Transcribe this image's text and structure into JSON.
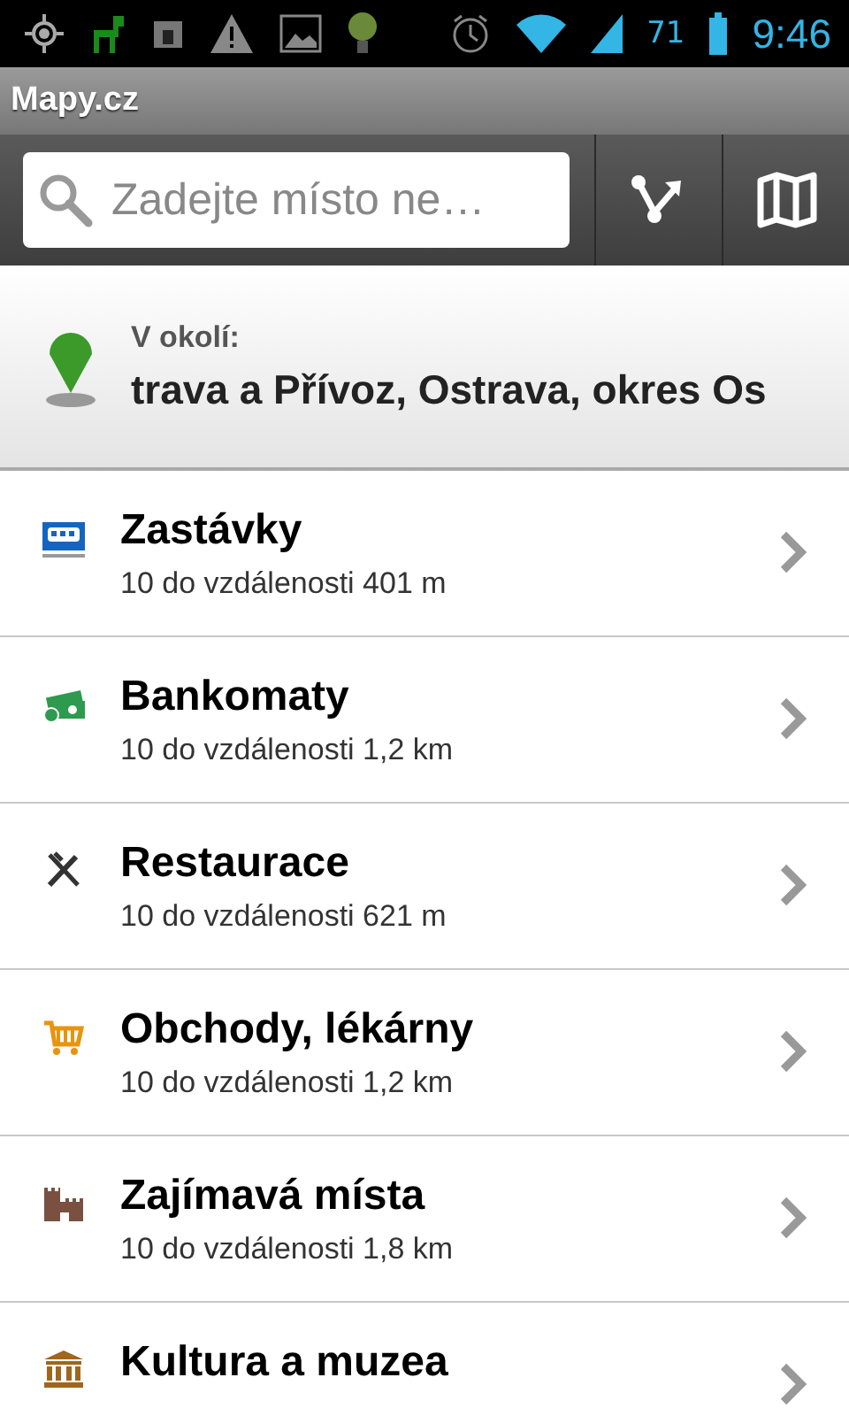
{
  "status_bar": {
    "battery": "71",
    "time": "9:46"
  },
  "app_title": "Mapy.cz",
  "search": {
    "placeholder": "Zadejte místo ne…"
  },
  "location": {
    "label": "V okolí:",
    "address": "trava a Přívoz, Ostrava, okres Os"
  },
  "categories": [
    {
      "kind": "bus",
      "title": "Zastávky",
      "subtitle": "10 do vzdálenosti 401 m"
    },
    {
      "kind": "cash",
      "title": "Bankomaty",
      "subtitle": "10 do vzdálenosti 1,2 km"
    },
    {
      "kind": "food",
      "title": "Restaurace",
      "subtitle": "10 do vzdálenosti 621 m"
    },
    {
      "kind": "shop",
      "title": "Obchody, lékárny",
      "subtitle": "10 do vzdálenosti 1,2 km"
    },
    {
      "kind": "sight",
      "title": "Zajímavá místa",
      "subtitle": "10 do vzdálenosti 1,8 km"
    },
    {
      "kind": "museum",
      "title": "Kultura a muzea"
    }
  ]
}
